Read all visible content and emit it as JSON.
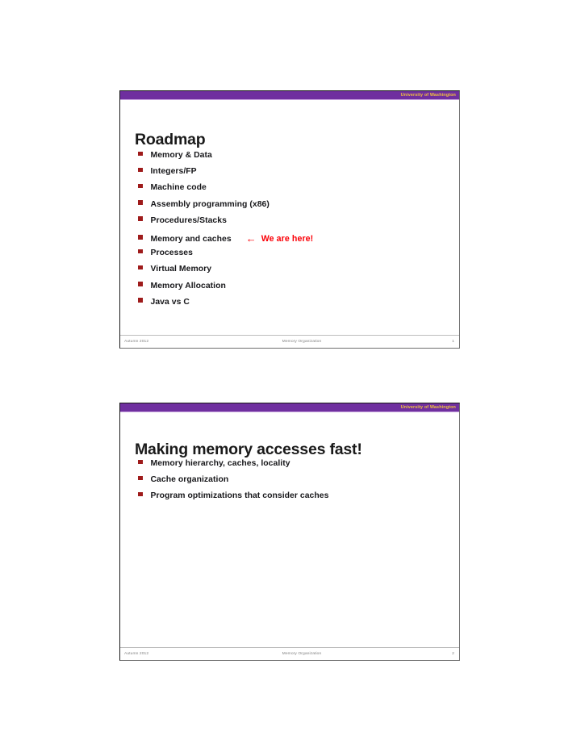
{
  "document": {
    "type": "lecture-slide-handout",
    "page_background": "#ffffff"
  },
  "theme": {
    "banner_color": "#6f2f9f",
    "banner_underline_color": "#c9a6e0",
    "banner_text_color": "#f2c43d",
    "bullet_color": "#9e1b1b",
    "title_color": "#1a1a1a",
    "body_text_color": "#17171a",
    "callout_color": "#fb0007",
    "footer_text_color": "#808080"
  },
  "slides": [
    {
      "banner_label": "University of Washington",
      "title": "Roadmap",
      "bullets": [
        {
          "text": "Memory & Data"
        },
        {
          "text": "Integers/FP"
        },
        {
          "text": "Machine code"
        },
        {
          "text": "Assembly programming (x86)"
        },
        {
          "text": "Procedures/Stacks"
        },
        {
          "text": "Memory and caches",
          "callout": {
            "arrow": "←",
            "text": "We are here!"
          }
        },
        {
          "text": "Processes"
        },
        {
          "text": "Virtual Memory"
        },
        {
          "text": "Memory Allocation"
        },
        {
          "text": "Java vs C"
        }
      ],
      "footer": {
        "left": "Autumn 2012",
        "center": "Memory Organization",
        "right": "1"
      }
    },
    {
      "banner_label": "University of Washington",
      "title": "Making memory accesses fast!",
      "bullets": [
        {
          "text": "Memory hierarchy, caches, locality"
        },
        {
          "text": "Cache organization"
        },
        {
          "text": "Program optimizations that consider caches"
        }
      ],
      "footer": {
        "left": "Autumn 2012",
        "center": "Memory Organization",
        "right": "2"
      }
    }
  ]
}
